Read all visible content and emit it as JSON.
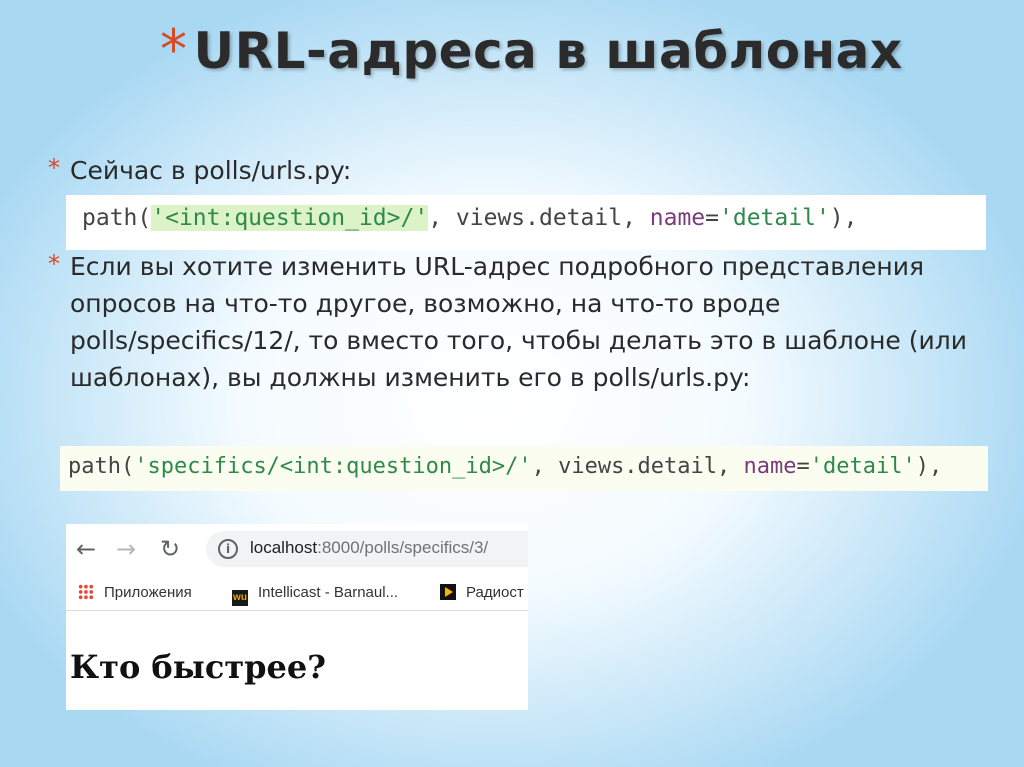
{
  "slide": {
    "title_star": "*",
    "title": "URL-адреса в шаблонах",
    "bullets": [
      {
        "star": "*",
        "text": "Сейчас в polls/urls.py:"
      },
      {
        "star": "*",
        "text": "Если вы хотите изменить URL-адрес подробного представления опросов на что-то другое, возможно, на что-то вроде polls/specifics/12/, то вместо того, чтобы делать это в шаблоне (или шаблонах), вы должны изменить его в polls/urls.py:"
      }
    ],
    "code1": {
      "p1": "path(",
      "p2": "'<int:question_id>/'",
      "p3": ", views.detail, ",
      "p4": "name",
      "p5": "=",
      "p6": "'detail'",
      "p7": "),"
    },
    "code2": {
      "p1": "path(",
      "p2": "'specifics/<int:question_id>/'",
      "p3": ", views.detail, ",
      "p4": "name",
      "p5": "=",
      "p6": "'detail'",
      "p7": "),"
    }
  },
  "browser": {
    "nav": {
      "back": "←",
      "forward": "→",
      "reload": "↻",
      "info": "i"
    },
    "url_host": "localhost",
    "url_path": ":8000/polls/specifics/3/",
    "bookmarks": [
      {
        "label": "Приложения",
        "icon": "apps-grid-icon"
      },
      {
        "label": "Intellicast - Barnaul...",
        "icon": "wu-icon"
      },
      {
        "label": "Радиост",
        "icon": "play-icon"
      }
    ],
    "wu_text": "wu",
    "page_heading": "Кто быстрее?"
  },
  "colors": {
    "accent_star": "#d64a26",
    "string_green": "#2f8a4a",
    "keyword_purple": "#7a3b7e"
  }
}
